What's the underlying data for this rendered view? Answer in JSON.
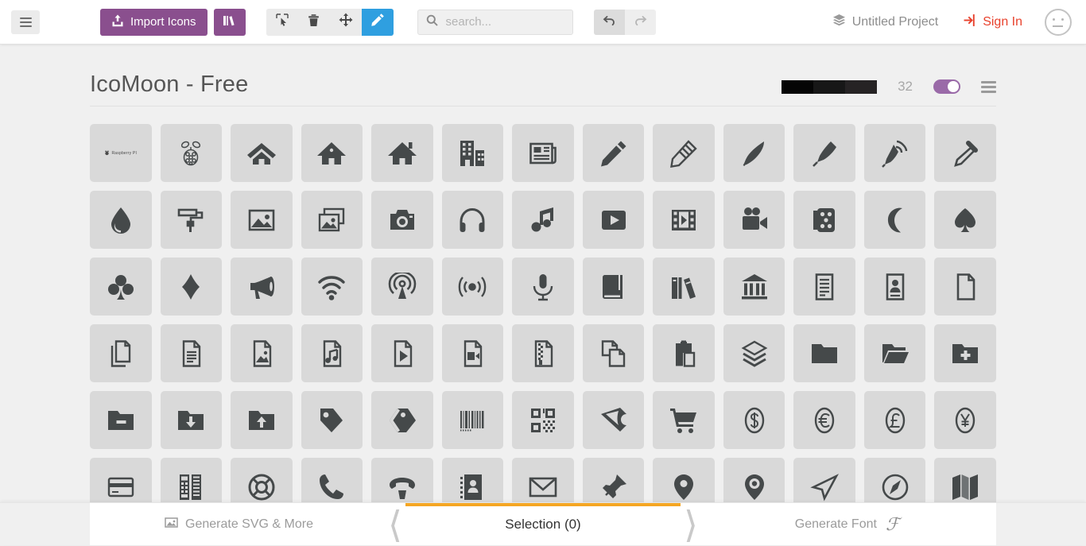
{
  "header": {
    "menu_icon": "hamburger-icon",
    "import_label": "Import Icons",
    "import_icon": "upload-icon",
    "library_icon": "books-icon",
    "tools": [
      {
        "name": "select-tool",
        "icon": "cursor-icon",
        "active": false
      },
      {
        "name": "delete-tool",
        "icon": "trash-icon",
        "active": false
      },
      {
        "name": "move-tool",
        "icon": "move-arrows-icon",
        "active": false
      },
      {
        "name": "edit-tool",
        "icon": "pencil-icon",
        "active": true
      }
    ],
    "search": {
      "value": "",
      "placeholder": "search...",
      "icon": "search-icon"
    },
    "undo": {
      "icon": "undo-arrow-icon",
      "enabled": true
    },
    "redo": {
      "icon": "redo-arrow-icon",
      "enabled": false
    },
    "project_label": "Untitled Project",
    "project_icon": "layers-icon",
    "signin_label": "Sign In",
    "signin_icon": "login-icon",
    "avatar_icon": "neutral-face-icon"
  },
  "set": {
    "title": "IcoMoon - Free",
    "swatches": [
      "#050505",
      "#171717",
      "#262324"
    ],
    "size": "32",
    "toggle_on": true,
    "menu_icon": "list-menu-icon"
  },
  "colors": {
    "purple": "#8a4f8e",
    "blue_active": "#2f9fe0",
    "orange": "#f5a623",
    "red": "#e8412c",
    "tile_bg": "#d9d9d9",
    "glyph": "#45494a"
  },
  "grid": {
    "rows": [
      [
        "raspberry-pi-wordmark-icon",
        "raspberry-icon",
        "home-icon",
        "home2-icon",
        "home3-icon",
        "office-icon",
        "newspaper-icon",
        "pencil-icon",
        "pencil2-icon",
        "quill-icon",
        "pen-icon",
        "blog-icon",
        "eyedropper-icon"
      ],
      [
        "droplet-icon",
        "paint-format-icon",
        "image-icon",
        "images-icon",
        "camera-icon",
        "headphones-icon",
        "music-icon",
        "play-icon",
        "film-icon",
        "video-camera-icon",
        "dice-icon",
        "pacman-icon",
        "spades-icon"
      ],
      [
        "clubs-icon",
        "diamonds-icon",
        "bullhorn-icon",
        "connection-icon",
        "podcast-icon",
        "feed-icon",
        "mic-icon",
        "book-icon",
        "books-icon",
        "library-icon",
        "file-text-icon",
        "profile-icon",
        "file-empty-icon"
      ],
      [
        "files-empty-icon",
        "file-text2-icon",
        "file-picture-icon",
        "file-music-icon",
        "file-play-icon",
        "file-video-icon",
        "file-zip-icon",
        "copy-icon",
        "paste-icon",
        "stack-icon",
        "folder-icon",
        "folder-open-icon",
        "folder-plus-icon"
      ],
      [
        "folder-minus-icon",
        "folder-download-icon",
        "folder-upload-icon",
        "price-tag-icon",
        "price-tags-icon",
        "barcode-icon",
        "qrcode-icon",
        "ticket-icon",
        "cart-icon",
        "coin-dollar-icon",
        "coin-euro-icon",
        "coin-pound-icon",
        "coin-yen-icon"
      ],
      [
        "credit-card-icon",
        "calculator-icon",
        "lifebuoy-icon",
        "phone-icon",
        "phone-hang-up-icon",
        "address-book-icon",
        "envelop-icon",
        "pushpin-icon",
        "location-icon",
        "location2-icon",
        "compass-icon",
        "compass2-icon",
        "map-icon"
      ]
    ]
  },
  "footer": {
    "generate_svg_label": "Generate SVG & More",
    "generate_svg_icon": "image-icon",
    "selection_label": "Selection (0)",
    "generate_font_label": "Generate Font",
    "generate_font_icon": "font-f-icon",
    "prev_icon": "chevron-left-icon",
    "next_icon": "chevron-right-icon"
  }
}
